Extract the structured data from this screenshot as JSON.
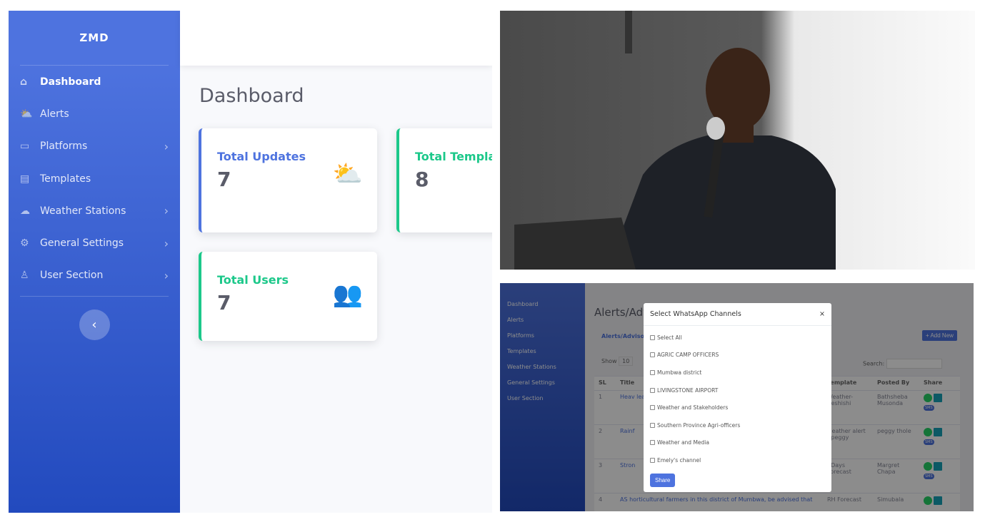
{
  "dashboard": {
    "brand": "ZMD",
    "nav": [
      {
        "label": "Dashboard",
        "icon": "home-icon",
        "active": true,
        "chevron": false
      },
      {
        "label": "Alerts",
        "icon": "cloud-sun-icon",
        "chevron": false
      },
      {
        "label": "Platforms",
        "icon": "desktop-icon",
        "chevron": true
      },
      {
        "label": "Templates",
        "icon": "file-icon",
        "chevron": false
      },
      {
        "label": "Weather Stations",
        "icon": "cloud-icon",
        "chevron": true
      },
      {
        "label": "General Settings",
        "icon": "gear-icon",
        "chevron": true
      },
      {
        "label": "User Section",
        "icon": "user-icon",
        "chevron": true
      }
    ],
    "title": "Dashboard",
    "cards": [
      {
        "label": "Total Updates",
        "value": "7",
        "color": "#4e73df",
        "icon": "cloud-sun-icon"
      },
      {
        "label": "Total Templa",
        "value": "8",
        "color": "#1cc88a"
      },
      {
        "label": "Total Users",
        "value": "7",
        "color": "#1cc88a",
        "icon": "users-icon"
      }
    ]
  },
  "alerts_screen": {
    "nav": [
      "Dashboard",
      "Alerts",
      "Platforms",
      "Templates",
      "Weather Stations",
      "General Settings",
      "User Section"
    ],
    "title": "Alerts/Adv",
    "subtitle": "Alerts/Advisor",
    "add_new": "+ Add New",
    "show": "Show",
    "show_value": "10",
    "search": "Search:",
    "columns": [
      "SL",
      "Title",
      "Template",
      "Posted By",
      "Share"
    ],
    "rows": [
      {
        "sl": "1",
        "title": "Heav lead t preca",
        "template": "Weather-Beshishi",
        "posted_by": "Bathsheba Musonda"
      },
      {
        "sl": "2",
        "title": "Rainf",
        "template": "weather alert - peggy",
        "posted_by": "peggy thole"
      },
      {
        "sl": "3",
        "title": "Stron",
        "template": "7Days Forecast",
        "posted_by": "Margret Chapa"
      },
      {
        "sl": "4",
        "title": "AS horticultural farmers in this district of Mumbwa, be advised that",
        "template": "RH Forecast",
        "posted_by": "Simubala"
      }
    ],
    "modal": {
      "title": "Select WhatsApp Channels",
      "close": "×",
      "options": [
        "Select All",
        "AGRIC CAMP OFFICERS",
        "Mumbwa district",
        "LIVINGSTONE AIRPORT",
        "Weather and Stakeholders",
        "Southern Province Agri-officers",
        "Weather and Media",
        "Emely's channel"
      ],
      "share": "Share"
    },
    "sms_label": "SMS"
  }
}
